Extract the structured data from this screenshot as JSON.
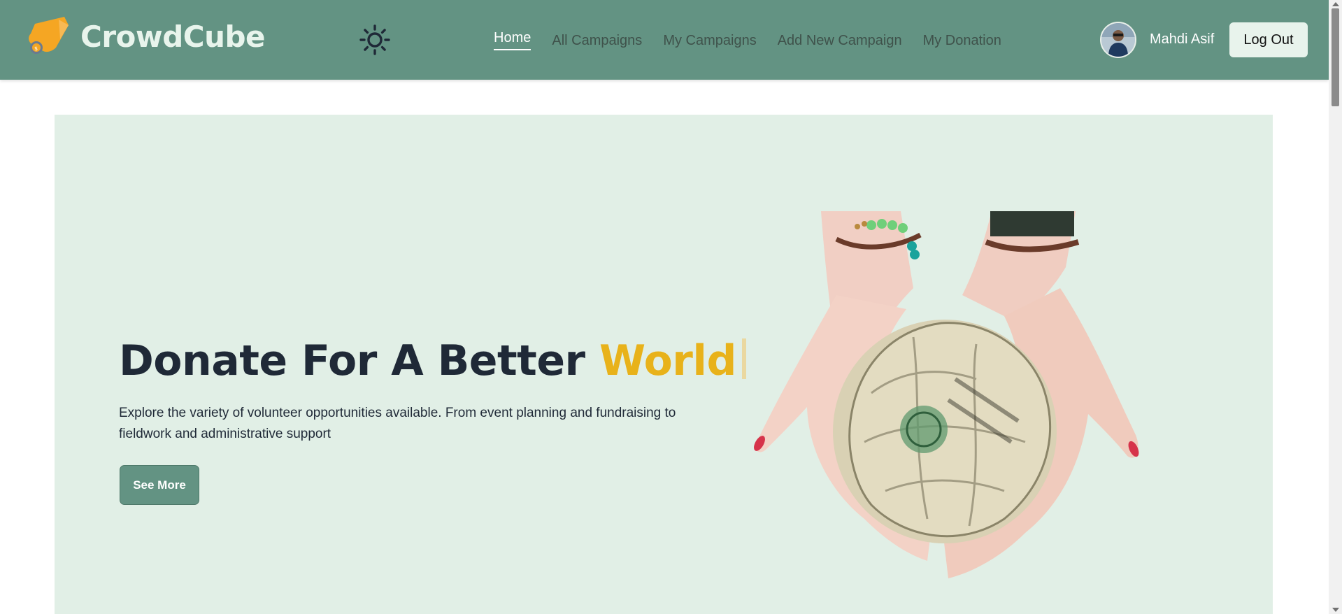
{
  "brand": {
    "name": "CrowdCube",
    "logo_icon": "crowdfunding-hand-coin-icon"
  },
  "theme_toggle": {
    "icon": "sun-icon"
  },
  "nav": {
    "links": [
      {
        "label": "Home",
        "active": true
      },
      {
        "label": "All Campaigns",
        "active": false
      },
      {
        "label": "My Campaigns",
        "active": false
      },
      {
        "label": "Add New Campaign",
        "active": false
      },
      {
        "label": "My Donation",
        "active": false
      }
    ]
  },
  "user": {
    "name": "Mahdi Asif",
    "logout_label": "Log Out"
  },
  "hero": {
    "title_main": "Donate For A Better ",
    "title_accent": "World",
    "description": "Explore the variety of volunteer opportunities available. From event planning and fundraising to fieldwork and administrative support",
    "cta_label": "See More",
    "image": "hands-holding-crumpled-dollar-bill"
  },
  "colors": {
    "navbar": "#639383",
    "hero_bg": "#e1efe6",
    "accent": "#e8b21a",
    "button": "#639383",
    "text_dark": "#1f2937"
  }
}
